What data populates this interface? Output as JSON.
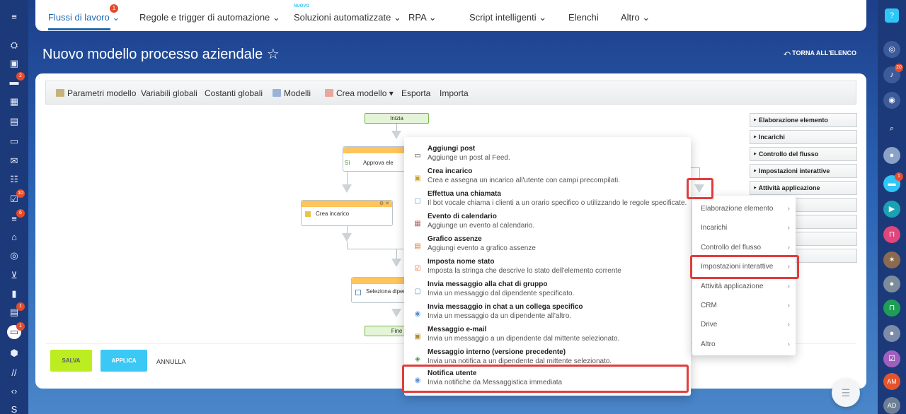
{
  "nav": {
    "items": [
      "Flussi di lavoro",
      "Regole e trigger di automazione",
      "Soluzioni automatizzate",
      "RPA",
      "Script intelligenti",
      "Elenchi",
      "Altro"
    ],
    "badge": "1",
    "new_label": "NUOVO"
  },
  "page": {
    "title": "Nuovo modello processo aziendale ☆",
    "back_link": "⤺ TORNA ALL'ELENCO"
  },
  "toolbar": {
    "items": [
      "Parametri modello",
      "Variabili globali",
      "Costanti globali",
      "Modelli",
      "Crea modello ▾",
      "Esporta",
      "Importa"
    ]
  },
  "diagram": {
    "start": "Inizia",
    "end": "Fine",
    "si": "Sì",
    "approve": "Approva ele",
    "create_task": "Crea incarico",
    "select": "Seleziona dipen",
    "node_icons": "⚙ ✕"
  },
  "palette": [
    "Elaborazione elemento",
    "Incarichi",
    "Controllo del flusso",
    "Impostazioni interattive",
    "Attività applicazione"
  ],
  "buttons": {
    "save": "SALVA",
    "apply": "APPLICA",
    "cancel": "ANNULLA"
  },
  "popup": {
    "items": [
      {
        "title": "Aggiungi post",
        "desc": "Aggiunge un post al Feed."
      },
      {
        "title": "Crea incarico",
        "desc": "Crea e assegna un incarico all'utente con campi precompilati."
      },
      {
        "title": "Effettua una chiamata",
        "desc": "Il bot vocale chiama i clienti a un orario specifico o utilizzando le regole specificate."
      },
      {
        "title": "Evento di calendario",
        "desc": "Aggiunge un evento al calendario."
      },
      {
        "title": "Grafico assenze",
        "desc": "Aggiungi evento a grafico assenze"
      },
      {
        "title": "Imposta nome stato",
        "desc": "Imposta la stringa che descrive lo stato dell'elemento corrente"
      },
      {
        "title": "Invia messaggio alla chat di gruppo",
        "desc": "Invia un messaggio dal dipendente specificato."
      },
      {
        "title": "Invia messaggio in chat a un collega specifico",
        "desc": "Invia un messaggio da un dipendente all'altro."
      },
      {
        "title": "Messaggio e-mail",
        "desc": "Invia un messaggio a un dipendente dal mittente selezionato."
      },
      {
        "title": "Messaggio interno (versione precedente)",
        "desc": "Invia una notifica a un dipendente dal mittente selezionato."
      },
      {
        "title": "Notifica utente",
        "desc": "Invia notifiche da Messaggistica immediata"
      }
    ]
  },
  "submenu": {
    "items": [
      "Elaborazione elemento",
      "Incarichi",
      "Controllo del flusso",
      "Impostazioni interattive",
      "Attività applicazione",
      "CRM",
      "Drive",
      "Altro"
    ],
    "arrow": "›"
  },
  "left_sidebar": {
    "badges": [
      "2",
      "10",
      "6",
      "1",
      "1"
    ]
  },
  "right_sidebar": {
    "badges": [
      "20",
      "1"
    ],
    "avatars": [
      "AM",
      "AD"
    ]
  }
}
